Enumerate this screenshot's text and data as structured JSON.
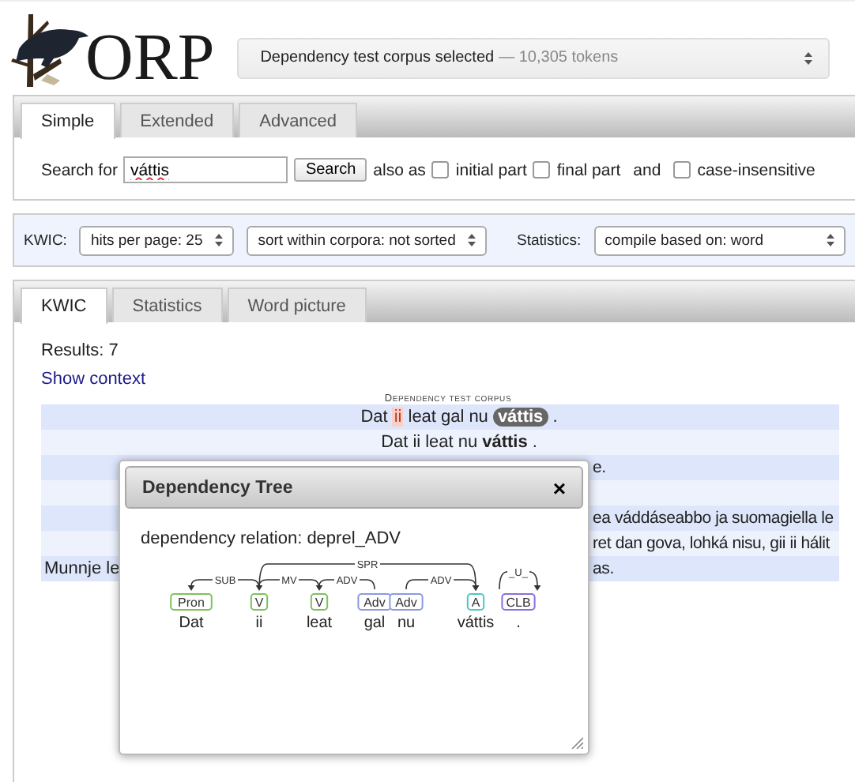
{
  "logo": {
    "text": "ORP"
  },
  "corpus_selector": {
    "label": "Dependency test corpus selected",
    "detail": "— 10,305 tokens"
  },
  "search_tabs": [
    {
      "label": "Simple",
      "selected": true
    },
    {
      "label": "Extended",
      "selected": false
    },
    {
      "label": "Advanced",
      "selected": false
    }
  ],
  "search": {
    "label": "Search for",
    "value": "váttis",
    "button": "Search",
    "also_as": "also as",
    "and": "and",
    "options": [
      {
        "label": "initial part",
        "checked": false
      },
      {
        "label": "final part",
        "checked": false
      },
      {
        "label": "case-insensitive",
        "checked": false
      }
    ]
  },
  "options_bar": {
    "kwic_label": "KWIC:",
    "hits_per_page": "hits per page: 25",
    "sort": "sort within corpora: not sorted",
    "statistics_label": "Statistics:",
    "compile": "compile based on: word"
  },
  "result_tabs": [
    {
      "label": "KWIC",
      "selected": true
    },
    {
      "label": "Statistics",
      "selected": false
    },
    {
      "label": "Word picture",
      "selected": false
    }
  ],
  "results_count": "Results: 7",
  "show_context": "Show context",
  "corpus_heading": "Dependency test corpus",
  "kwic_rows": [
    {
      "kind": "tokens",
      "tokens": [
        {
          "text": "Dat",
          "kind": "plain"
        },
        {
          "text": "ii",
          "kind": "dep"
        },
        {
          "text": "leat",
          "kind": "plain"
        },
        {
          "text": "gal",
          "kind": "plain"
        },
        {
          "text": "nu",
          "kind": "plain"
        },
        {
          "text": "váttis",
          "kind": "match"
        },
        {
          "text": ".",
          "kind": "plain"
        }
      ]
    },
    {
      "kind": "tokens",
      "tokens": [
        {
          "text": "Dat",
          "kind": "plain"
        },
        {
          "text": "ii",
          "kind": "plain"
        },
        {
          "text": "leat",
          "kind": "plain"
        },
        {
          "text": "nu",
          "kind": "plain"
        },
        {
          "text": "váttis",
          "kind": "bold"
        },
        {
          "text": ".",
          "kind": "plain"
        }
      ]
    },
    {
      "kind": "split",
      "right": "e."
    },
    {
      "kind": "split"
    },
    {
      "kind": "split",
      "right": "ea váddáseabbo ja suomagiella le"
    },
    {
      "kind": "split",
      "right": "ret dan gova, lohká nisu, gii ii hálit"
    },
    {
      "kind": "split",
      "left": "Munnje le",
      "right": "as."
    }
  ],
  "dialog": {
    "title": "Dependency Tree",
    "close": "×",
    "relation": "dependency relation: deprel_ADV",
    "tree": {
      "nodes": [
        {
          "tag": "Pron",
          "word": "Dat",
          "color": "#7cc25a"
        },
        {
          "tag": "V",
          "word": "ii",
          "color": "#7cc25a"
        },
        {
          "tag": "V",
          "word": "leat",
          "color": "#7cc25a"
        },
        {
          "tag": "Adv",
          "word": "gal",
          "color": "#8c9ae0"
        },
        {
          "tag": "Adv",
          "word": "nu",
          "color": "#8c9ae0"
        },
        {
          "tag": "A",
          "word": "váttis",
          "color": "#4fc6c6"
        },
        {
          "tag": "CLB",
          "word": ".",
          "color": "#8a6fdc"
        }
      ],
      "arcs": [
        {
          "label": "SUB"
        },
        {
          "label": "MV"
        },
        {
          "label": "ADV"
        },
        {
          "label": "SPR"
        },
        {
          "label": "ADV"
        },
        {
          "label": "_U_"
        }
      ]
    }
  }
}
